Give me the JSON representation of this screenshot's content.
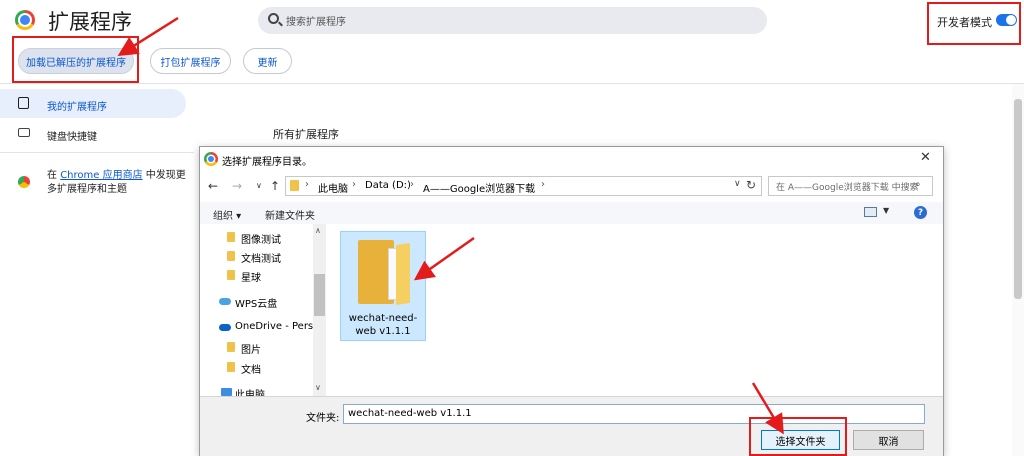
{
  "header": {
    "title": "扩展程序",
    "search_placeholder": "搜索扩展程序",
    "dev_mode_label": "开发者模式",
    "dev_mode_on": true
  },
  "toolbar": {
    "load_unpacked": "加载已解压的扩展程序",
    "pack": "打包扩展程序",
    "update": "更新"
  },
  "sidebar": {
    "items": [
      {
        "label": "我的扩展程序",
        "icon": "puzzle-icon",
        "active": true
      },
      {
        "label": "键盘快捷键",
        "icon": "keyboard-icon",
        "active": false
      }
    ],
    "store_prefix": "在 ",
    "store_link": "Chrome 应用商店",
    "store_suffix": " 中发现更多扩展程序和主题"
  },
  "main": {
    "section_title": "所有扩展程序"
  },
  "dialog": {
    "title": "选择扩展程序目录。",
    "breadcrumb": [
      "此电脑",
      "Data (D:)",
      "A——Google浏览器下载"
    ],
    "search_placeholder": "在 A——Google浏览器下载 中搜索",
    "organize": "组织 ▾",
    "new_folder": "新建文件夹",
    "tree": [
      {
        "label": "图像测试",
        "type": "folder"
      },
      {
        "label": "文档测试",
        "type": "folder"
      },
      {
        "label": "星球",
        "type": "folder"
      },
      {
        "label": "WPS云盘",
        "type": "cloud"
      },
      {
        "label": "OneDrive - Perso",
        "type": "onedrive"
      },
      {
        "label": "图片",
        "type": "folder"
      },
      {
        "label": "文档",
        "type": "folder"
      },
      {
        "label": "此电脑",
        "type": "pc"
      }
    ],
    "file": {
      "name": "wechat-need-web v1.1.1",
      "selected": true
    },
    "folder_label": "文件夹:",
    "folder_value": "wechat-need-web v1.1.1",
    "select_button": "选择文件夹",
    "cancel_button": "取消"
  },
  "colors": {
    "accent": "#0b57d0",
    "annotation": "#e31b1b",
    "toggle": "#1a73e8",
    "folder": "#f1c24a"
  }
}
